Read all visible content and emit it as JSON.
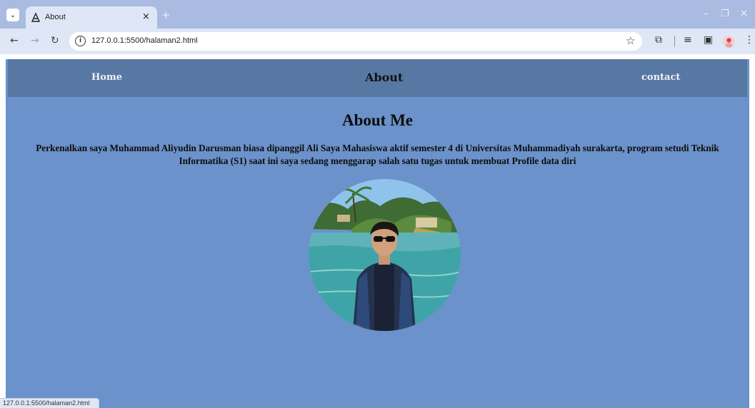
{
  "browser": {
    "tab_title": "About",
    "tab_close": "×",
    "new_tab": "+",
    "url": "127.0.0.1:5500/halaman2.html",
    "status_url": "127.0.0.1:5500/halaman2.html",
    "icons": [
      "tab-search-icon",
      "page-favicon-icon",
      "back-icon",
      "forward-icon",
      "reload-icon",
      "site-info-icon",
      "bookmark-star-icon",
      "extensions-icon",
      "reading-list-icon",
      "side-panel-icon",
      "profile-avatar-icon",
      "more-menu-icon",
      "minimize-icon",
      "restore-icon",
      "close-window-icon"
    ]
  },
  "nav": {
    "home": "Home",
    "about": "About",
    "contact": "contact"
  },
  "main": {
    "heading": "About Me",
    "intro": "Perkenalkan saya Muhammad Aliyudin Darusman biasa dipanggil Ali Saya Mahasiswa aktif semester 4 di Universitas Muhammadiyah surakarta, program setudi Teknik Informatika (S1) saat ini saya sedang menggarap salah satu tugas untuk membuat Profile data diri"
  },
  "colors": {
    "page_bg": "#6b92ca",
    "navbar_bg": "#5878a4",
    "chrome_tabbar": "#a9bbe0",
    "chrome_toolbar": "#dfe7f6"
  }
}
